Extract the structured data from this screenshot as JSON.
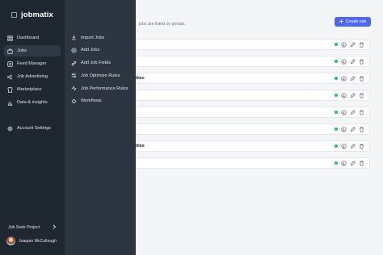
{
  "app": {
    "logo_text": "jobmatix"
  },
  "sidebar": {
    "items": [
      {
        "label": "Dashboard",
        "icon": "grid-icon"
      },
      {
        "label": "Jobs",
        "icon": "briefcase-icon",
        "active": true
      },
      {
        "label": "Feed Manager",
        "icon": "feed-icon"
      },
      {
        "label": "Job Advertising",
        "icon": "megaphone-icon"
      },
      {
        "label": "Marketplace",
        "icon": "store-icon"
      },
      {
        "label": "Data & insights",
        "icon": "chart-icon"
      }
    ],
    "settings_label": "Account Settings",
    "project_label": "Job Seek Project",
    "user_name": "Joaquin McCullough"
  },
  "submenu": {
    "items": [
      {
        "label": "Import Jobs",
        "icon": "import-icon"
      },
      {
        "label": "Add Jobs",
        "icon": "plus-circle-icon"
      },
      {
        "label": "Add Job Fields",
        "icon": "link-icon"
      },
      {
        "label": "Job Optimize Rules",
        "icon": "sliders-icon"
      },
      {
        "label": "Job Performance Rules",
        "icon": "activity-icon"
      },
      {
        "label": "Workflows",
        "icon": "workflow-icon"
      }
    ]
  },
  "main": {
    "subtitle": "jobs are listed on portals.",
    "create_label": "Create rule",
    "rows": [
      {
        "name": ""
      },
      {
        "name": ""
      },
      {
        "name": "ities"
      },
      {
        "name": ""
      },
      {
        "name": ""
      },
      {
        "name": ""
      },
      {
        "name": "ities"
      },
      {
        "name": ""
      }
    ],
    "status_color": "#22c55e",
    "accent_color": "#4f67ea"
  }
}
